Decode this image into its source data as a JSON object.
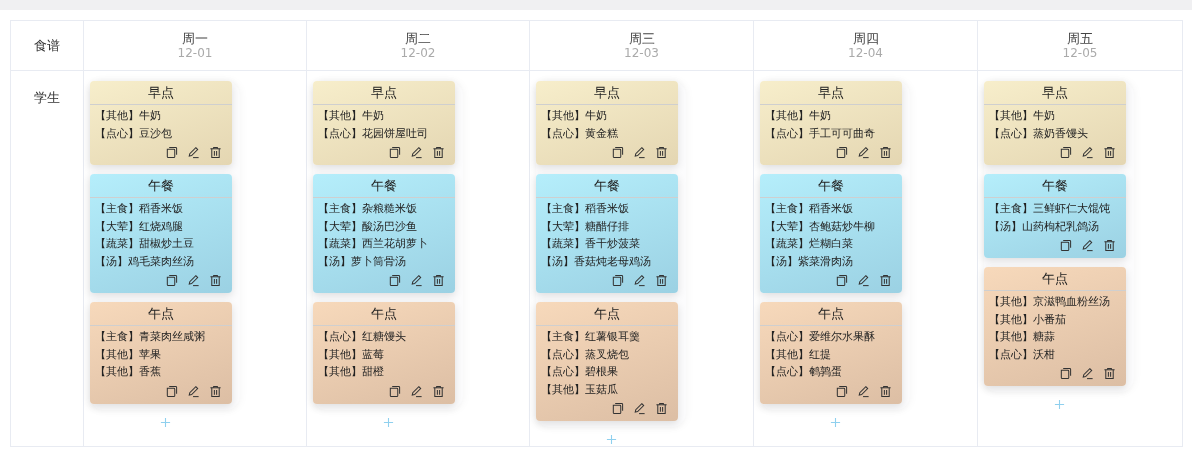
{
  "corner_label": "食谱",
  "row_label": "学生",
  "days": [
    {
      "weekday": "周一",
      "date": "12-01",
      "meals": [
        {
          "title": "早点",
          "kind": "breakfast",
          "items": [
            "【其他】牛奶",
            "【点心】豆沙包"
          ]
        },
        {
          "title": "午餐",
          "kind": "lunch",
          "items": [
            "【主食】稻香米饭",
            "【大荤】红烧鸡腿",
            "【蔬菜】甜椒炒土豆",
            "【汤】鸡毛菜肉丝汤"
          ]
        },
        {
          "title": "午点",
          "kind": "snack",
          "items": [
            "【主食】青菜肉丝咸粥",
            "【其他】苹果",
            "【其他】香蕉"
          ]
        }
      ]
    },
    {
      "weekday": "周二",
      "date": "12-02",
      "meals": [
        {
          "title": "早点",
          "kind": "breakfast",
          "items": [
            "【其他】牛奶",
            "【点心】花园饼屋吐司"
          ]
        },
        {
          "title": "午餐",
          "kind": "lunch",
          "items": [
            "【主食】杂粮糙米饭",
            "【大荤】酸汤巴沙鱼",
            "【蔬菜】西兰花胡萝卜",
            "【汤】萝卜筒骨汤"
          ]
        },
        {
          "title": "午点",
          "kind": "snack",
          "items": [
            "【点心】红糖馒头",
            "【其他】蓝莓",
            "【其他】甜橙"
          ]
        }
      ]
    },
    {
      "weekday": "周三",
      "date": "12-03",
      "meals": [
        {
          "title": "早点",
          "kind": "breakfast",
          "items": [
            "【其他】牛奶",
            "【点心】黄金糕"
          ]
        },
        {
          "title": "午餐",
          "kind": "lunch",
          "items": [
            "【主食】稻香米饭",
            "【大荤】糖醋仔排",
            "【蔬菜】香干炒菠菜",
            "【汤】香菇炖老母鸡汤"
          ]
        },
        {
          "title": "午点",
          "kind": "snack",
          "items": [
            "【主食】红薯银耳羹",
            "【点心】蒸叉烧包",
            "【点心】碧根果",
            "【其他】玉菇瓜"
          ]
        }
      ]
    },
    {
      "weekday": "周四",
      "date": "12-04",
      "meals": [
        {
          "title": "早点",
          "kind": "breakfast",
          "items": [
            "【其他】牛奶",
            "【点心】手工可可曲奇"
          ]
        },
        {
          "title": "午餐",
          "kind": "lunch",
          "items": [
            "【主食】稻香米饭",
            "【大荤】杏鲍菇炒牛柳",
            "【蔬菜】烂糊白菜",
            "【汤】紫菜滑肉汤"
          ]
        },
        {
          "title": "午点",
          "kind": "snack",
          "items": [
            "【点心】爱维尔水果酥",
            "【其他】红提",
            "【点心】鹌鹑蛋"
          ]
        }
      ]
    },
    {
      "weekday": "周五",
      "date": "12-05",
      "meals": [
        {
          "title": "早点",
          "kind": "breakfast",
          "items": [
            "【其他】牛奶",
            "【点心】蒸奶香馒头"
          ]
        },
        {
          "title": "午餐",
          "kind": "lunch",
          "items": [
            "【主食】三鲜虾仁大馄饨",
            "【汤】山药枸杞乳鸽汤"
          ]
        },
        {
          "title": "午点",
          "kind": "snack",
          "items": [
            "【其他】京滋鸭血粉丝汤",
            "【其他】小番茄",
            "【其他】糖蒜",
            "【点心】沃柑"
          ]
        }
      ]
    }
  ]
}
